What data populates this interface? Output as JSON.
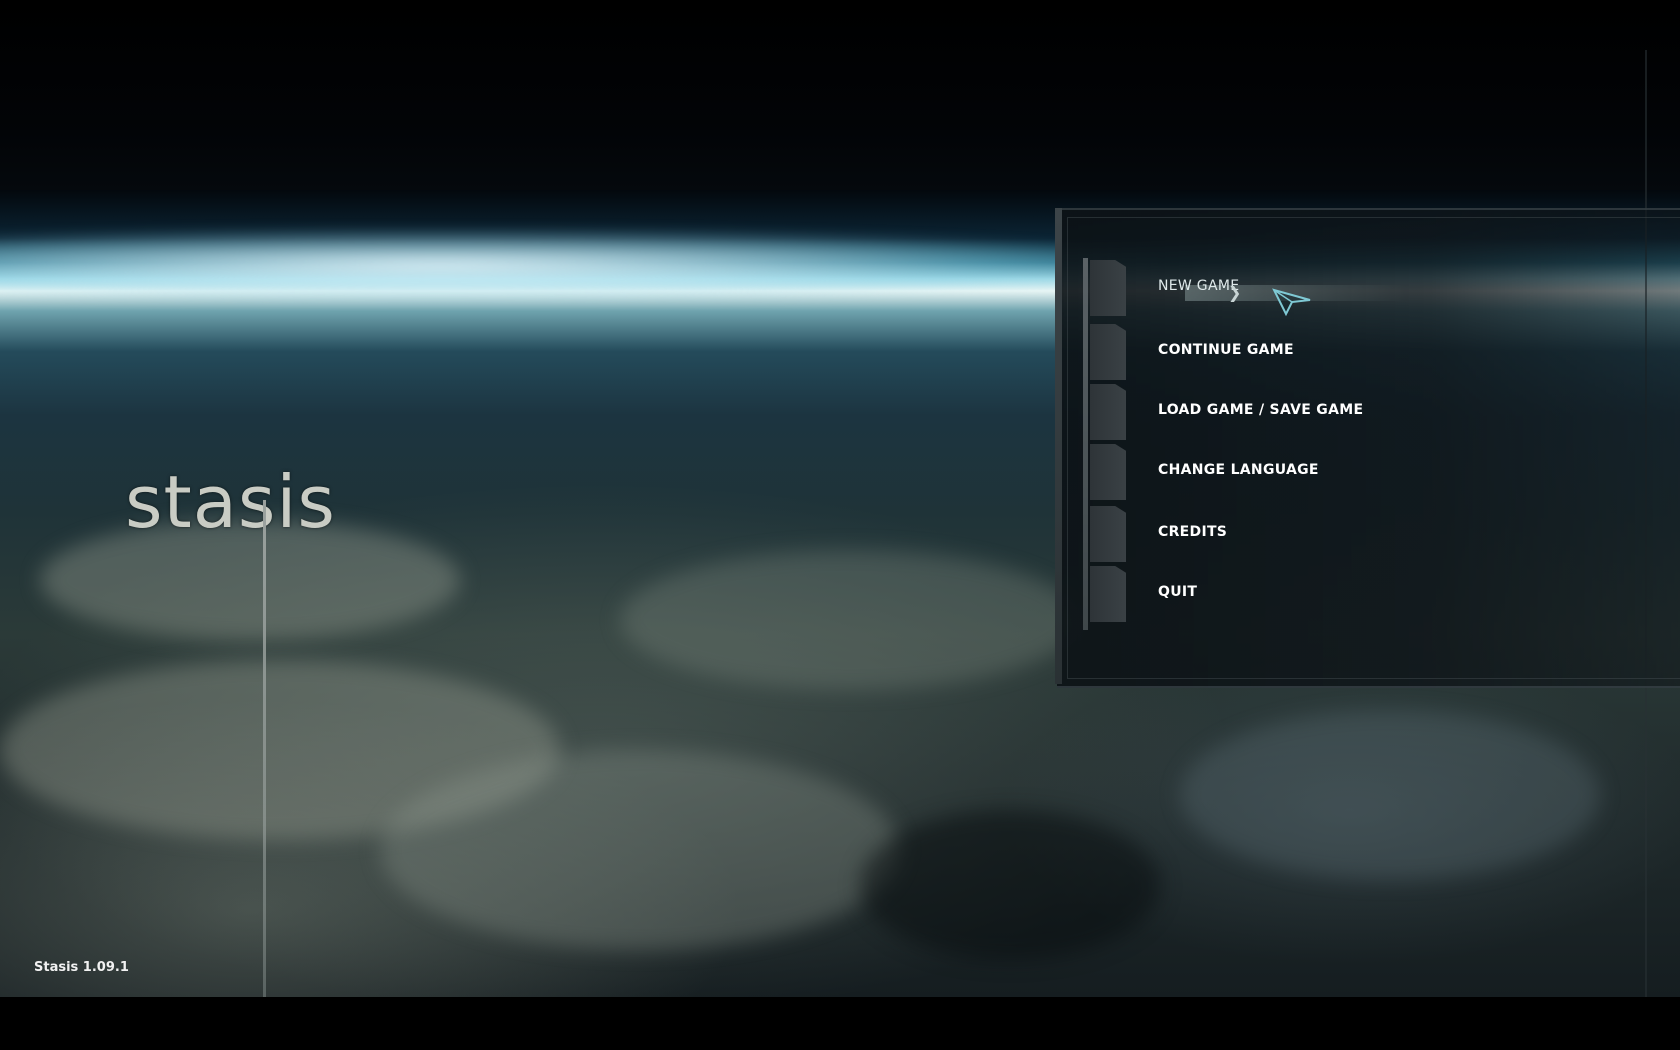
{
  "game": {
    "logo_text": "stasis",
    "version": "Stasis 1.09.1"
  },
  "menu": {
    "items": [
      {
        "label": "NEW GAME",
        "state": "hover"
      },
      {
        "label": "CONTINUE GAME"
      },
      {
        "label": "LOAD GAME / SAVE GAME"
      },
      {
        "label": "CHANGE LANGUAGE"
      },
      {
        "label": "CREDITS"
      },
      {
        "label": "QUIT"
      }
    ]
  },
  "colors": {
    "menu_text": "#ffffff",
    "panel_bg": "#0c1216",
    "atmosphere_glow": "#e9f6f5"
  }
}
